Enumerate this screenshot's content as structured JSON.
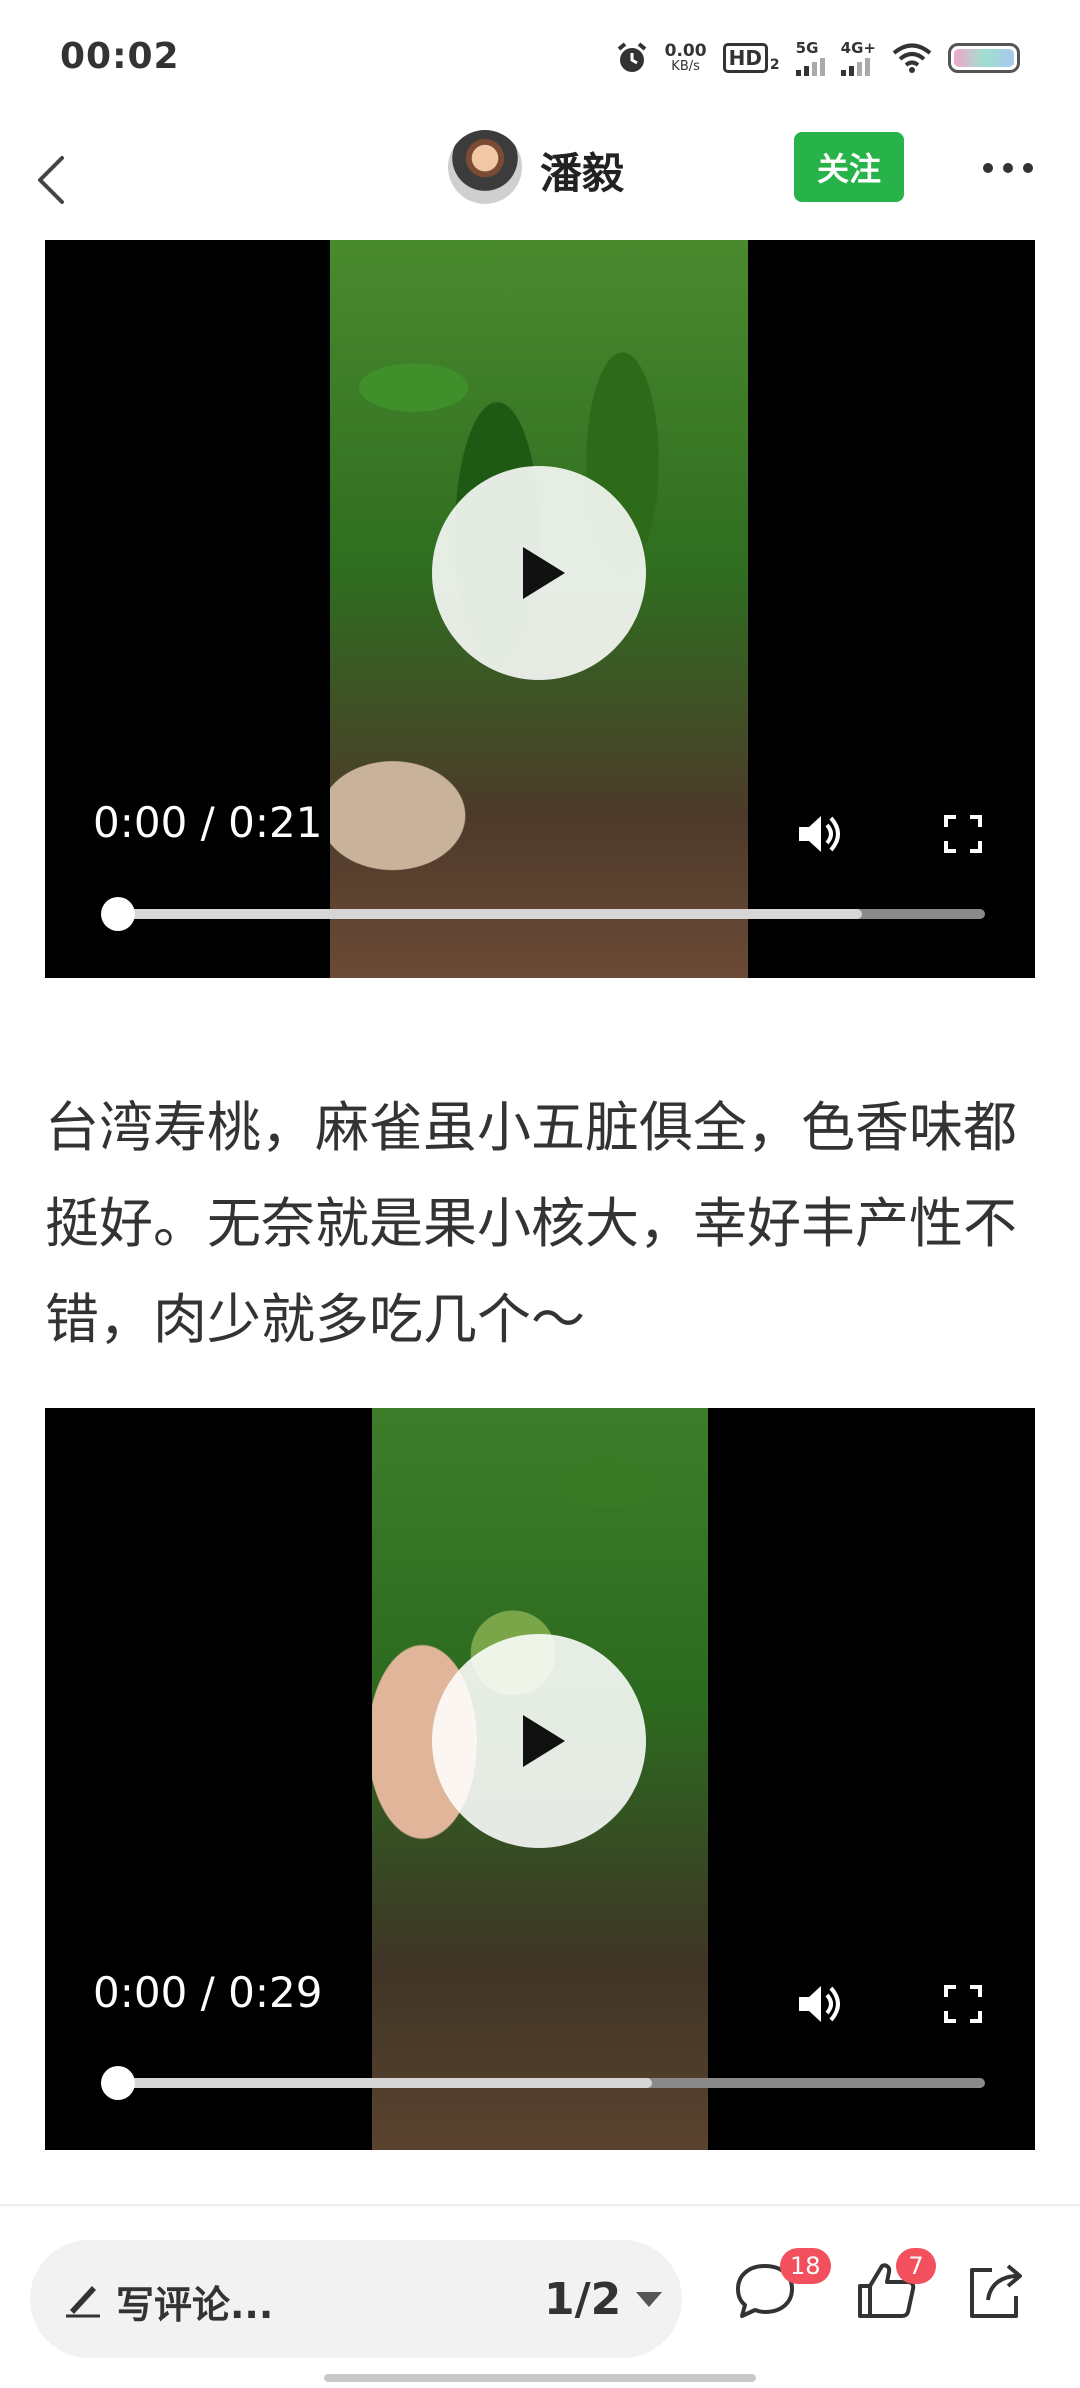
{
  "status_bar": {
    "time": "00:02",
    "net_speed_value": "0.00",
    "net_speed_unit": "KB/s",
    "hd_label": "HD",
    "hd_sub": "2",
    "signal1_label": "5G",
    "signal2_label": "4G+",
    "icons": [
      "alarm-icon",
      "wifi-icon",
      "battery-icon"
    ]
  },
  "header": {
    "author_name": "潘毅",
    "follow_label": "关注",
    "icons": [
      "back-arrow-icon",
      "more-dots-icon"
    ]
  },
  "videos": [
    {
      "time_display": "0:00 / 0:21",
      "buffered_fraction": 0.86
    },
    {
      "time_display": "0:00 / 0:29",
      "buffered_fraction": 0.62
    }
  ],
  "article": {
    "paragraph": "台湾寿桃，麻雀虽小五脏俱全，色香味都挺好。无奈就是果小核大，幸好丰产性不错，肉少就多吃几个～"
  },
  "bottom_bar": {
    "comment_placeholder": "写评论...",
    "page_indicator": "1/2",
    "comment_count": "18",
    "like_count": "7",
    "icons": [
      "pen-icon",
      "chevron-down-icon",
      "comment-bubble-icon",
      "thumbs-up-icon",
      "share-icon"
    ]
  },
  "colors": {
    "follow_green": "#27b24a",
    "badge_red": "#f2505c",
    "video_bg": "#000000"
  }
}
